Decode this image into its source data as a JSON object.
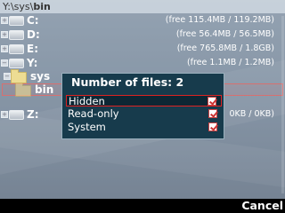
{
  "title": {
    "prefix": "Y:\\sys\\",
    "current": "bin"
  },
  "drives": [
    {
      "label": "C:",
      "info": "(free 115.4MB / 119.2MB)"
    },
    {
      "label": "D:",
      "info": "(free 56.4MB / 56.5MB)"
    },
    {
      "label": "E:",
      "info": "(free 765.8MB / 1.8GB)"
    },
    {
      "label": "Y:",
      "info": "(free 1.1MB / 1.2MB)"
    }
  ],
  "tree": {
    "sys_label": "sys",
    "bin_label": "bin",
    "z_label": "Z:",
    "z_info": "0KB / 0KB)"
  },
  "dialog": {
    "title": "Number of files: 2",
    "options": [
      {
        "label": "Hidden",
        "checked": true
      },
      {
        "label": "Read-only",
        "checked": true
      },
      {
        "label": "System",
        "checked": true
      }
    ]
  },
  "softkeys": {
    "right": "Cancel"
  },
  "colors": {
    "dialog_bg": "#173b4c",
    "accent": "#cc3333"
  }
}
